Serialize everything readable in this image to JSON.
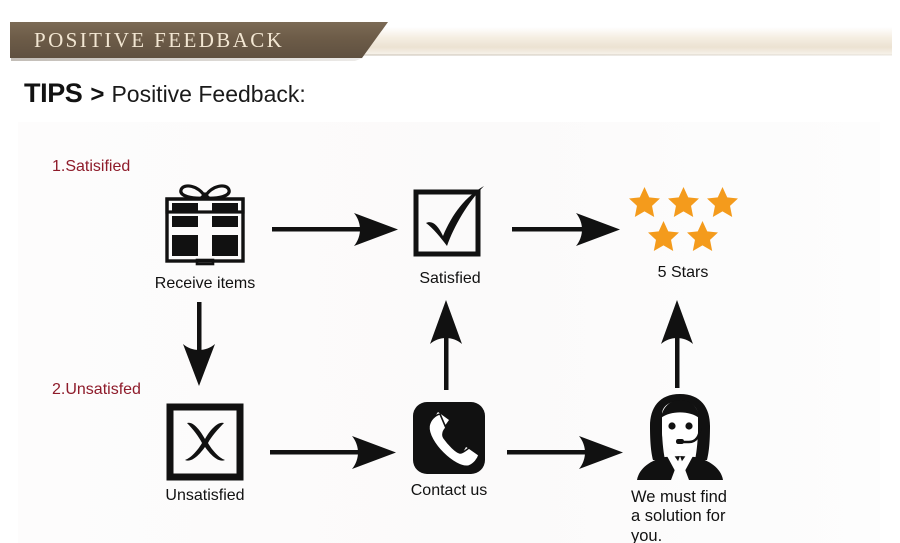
{
  "banner": {
    "title": "POSITIVE  FEEDBACK",
    "dark_color": "#6d5c48",
    "text_color": "#f2e6d2",
    "light_color": "#ece2d2"
  },
  "heading": {
    "strong": "TIPS",
    "separator": ">",
    "rest": "Positive Feedback:"
  },
  "steps": [
    {
      "label": "1.Satisified",
      "color": "#8e1b2a"
    },
    {
      "label": "2.Unsatisfed",
      "color": "#8e1b2a"
    }
  ],
  "flow": {
    "accent_star_color": "#f49b1c",
    "row1": [
      {
        "icon": "gift-box-icon",
        "caption": "Receive items"
      },
      {
        "icon": "checked-box-icon",
        "caption": "Satisfied"
      },
      {
        "icon": "five-stars-icon",
        "caption": "5 Stars"
      }
    ],
    "row2": [
      {
        "icon": "crossed-box-icon",
        "caption": "Unsatisfied"
      },
      {
        "icon": "telephone-icon",
        "caption": "Contact us"
      },
      {
        "icon": "support-agent-icon",
        "caption": "We must find\na solution for\nyou."
      }
    ]
  },
  "arrows": [
    {
      "name": "arrow-receive-to-satisfied",
      "direction": "right"
    },
    {
      "name": "arrow-satisfied-to-stars",
      "direction": "right"
    },
    {
      "name": "arrow-receive-to-unsatisfied",
      "direction": "down"
    },
    {
      "name": "arrow-unsatisfied-to-contact",
      "direction": "right"
    },
    {
      "name": "arrow-contact-to-agent",
      "direction": "right"
    },
    {
      "name": "arrow-contact-to-satisfied",
      "direction": "up"
    },
    {
      "name": "arrow-agent-to-stars",
      "direction": "up"
    }
  ]
}
